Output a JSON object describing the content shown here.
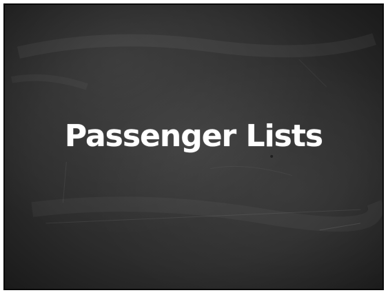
{
  "slide": {
    "title": "Passenger Lists",
    "background": "chalkboard",
    "colors": {
      "board": "#2e2e2e",
      "text": "#ffffff",
      "frame": "#ffffff"
    }
  }
}
